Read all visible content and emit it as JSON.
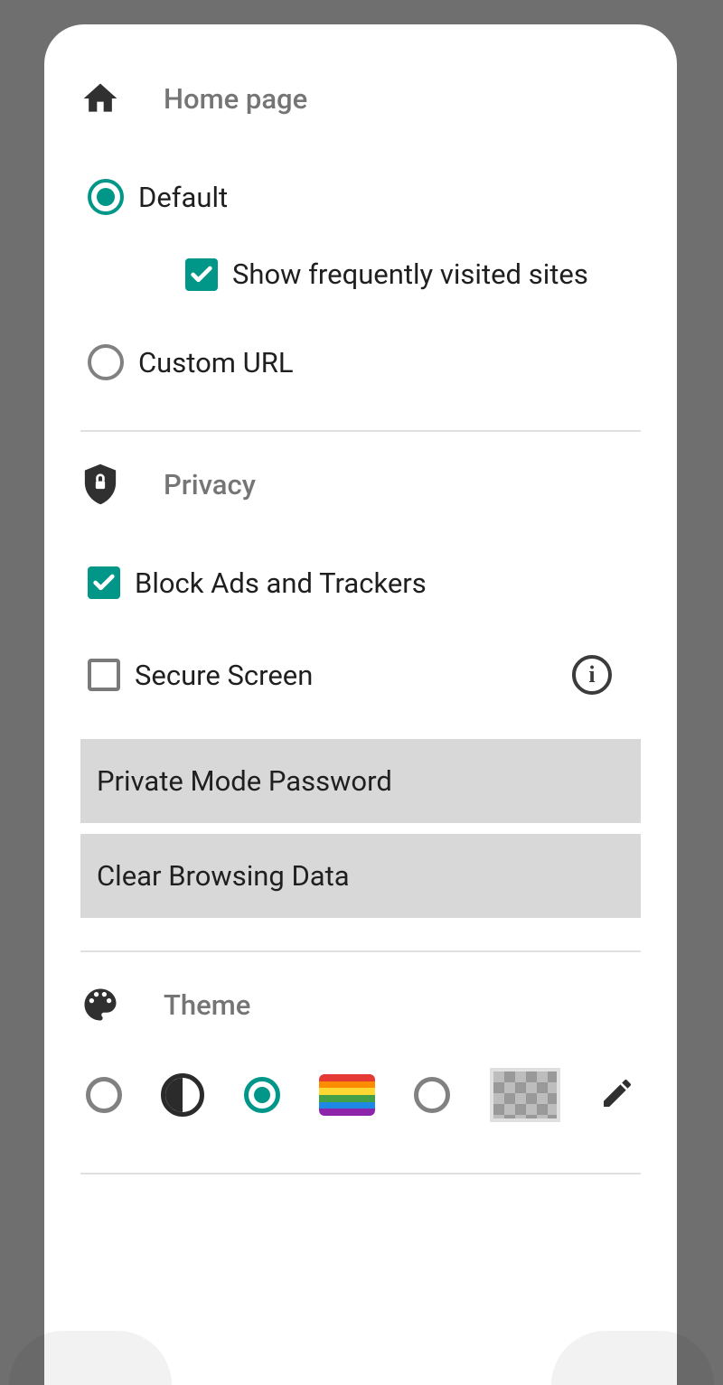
{
  "sections": {
    "homepage": {
      "title": "Home page",
      "options": {
        "default_label": "Default",
        "default_selected": true,
        "show_frequent_label": "Show frequently visited sites",
        "show_frequent_checked": true,
        "custom_url_label": "Custom URL",
        "custom_url_selected": false
      }
    },
    "privacy": {
      "title": "Privacy",
      "block_ads_label": "Block Ads and Trackers",
      "block_ads_checked": true,
      "secure_screen_label": "Secure Screen",
      "secure_screen_checked": false,
      "private_mode_password_label": "Private Mode Password",
      "clear_browsing_data_label": "Clear Browsing Data"
    },
    "theme": {
      "title": "Theme",
      "rainbow_colors": [
        "#e53935",
        "#fb8c00",
        "#fdd835",
        "#43a047",
        "#1e88e5",
        "#8e24aa"
      ]
    }
  }
}
